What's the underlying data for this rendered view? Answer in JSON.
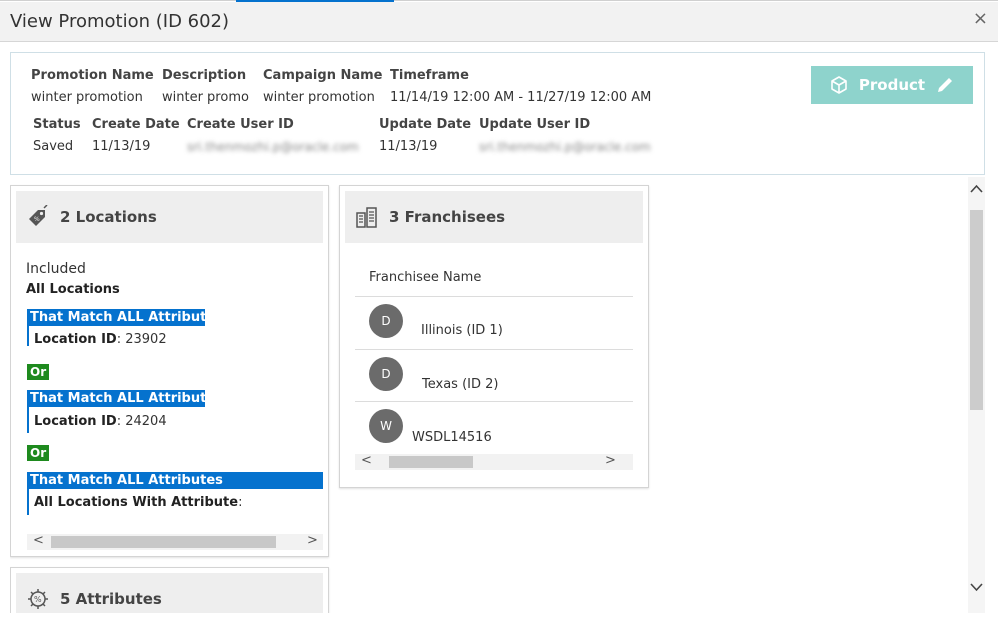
{
  "window": {
    "title": "View Promotion (ID 602)",
    "close_glyph": "×"
  },
  "summary": {
    "promotion_name_label": "Promotion Name",
    "promotion_name": "winter promotion",
    "description_label": "Description",
    "description": "winter promo",
    "campaign_name_label": "Campaign Name",
    "campaign_name": "winter promotion",
    "timeframe_label": "Timeframe",
    "timeframe": "11/14/19 12:00 AM - 11/27/19 12:00 AM",
    "status_label": "Status",
    "status": "Saved",
    "create_date_label": "Create Date",
    "create_date": "11/13/19",
    "create_user_label": "Create User ID",
    "create_user": "sri.thenmozhi.p@oracle.com",
    "update_date_label": "Update Date",
    "update_date": "11/13/19",
    "update_user_label": "Update User ID",
    "update_user": "sri.thenmozhi.p@oracle.com",
    "product_button_label": "Product",
    "product_button_color": "#8ed3cc"
  },
  "locations": {
    "title": "2 Locations",
    "included_label": "Included",
    "all_locations_label": "All Locations",
    "match_label": "That Match ALL Attributes",
    "location_id_label": "Location ID",
    "rule1_value": ": 23902",
    "or_label": "Or",
    "rule2_value": ": 24204",
    "all_with_attr_label": "All Locations With Attribute",
    "all_with_attr_suffix": ":",
    "scroll_left": "<",
    "scroll_right": ">"
  },
  "franchisees": {
    "title": "3 Franchisees",
    "column_header": "Franchisee Name",
    "rows": [
      {
        "initial": "D",
        "name": "Illinois (ID 1)"
      },
      {
        "initial": "D",
        "name": "Texas (ID 2)"
      },
      {
        "initial": "W",
        "name": "WSDL14516"
      }
    ],
    "scroll_left": "<",
    "scroll_right": ">"
  },
  "attributes": {
    "title": "5 Attributes"
  },
  "colors": {
    "accent": "#0572ce",
    "or_green": "#1e8a1e",
    "avatar": "#6b6b6b"
  },
  "vscroll": {
    "up": "^",
    "down": "v"
  }
}
